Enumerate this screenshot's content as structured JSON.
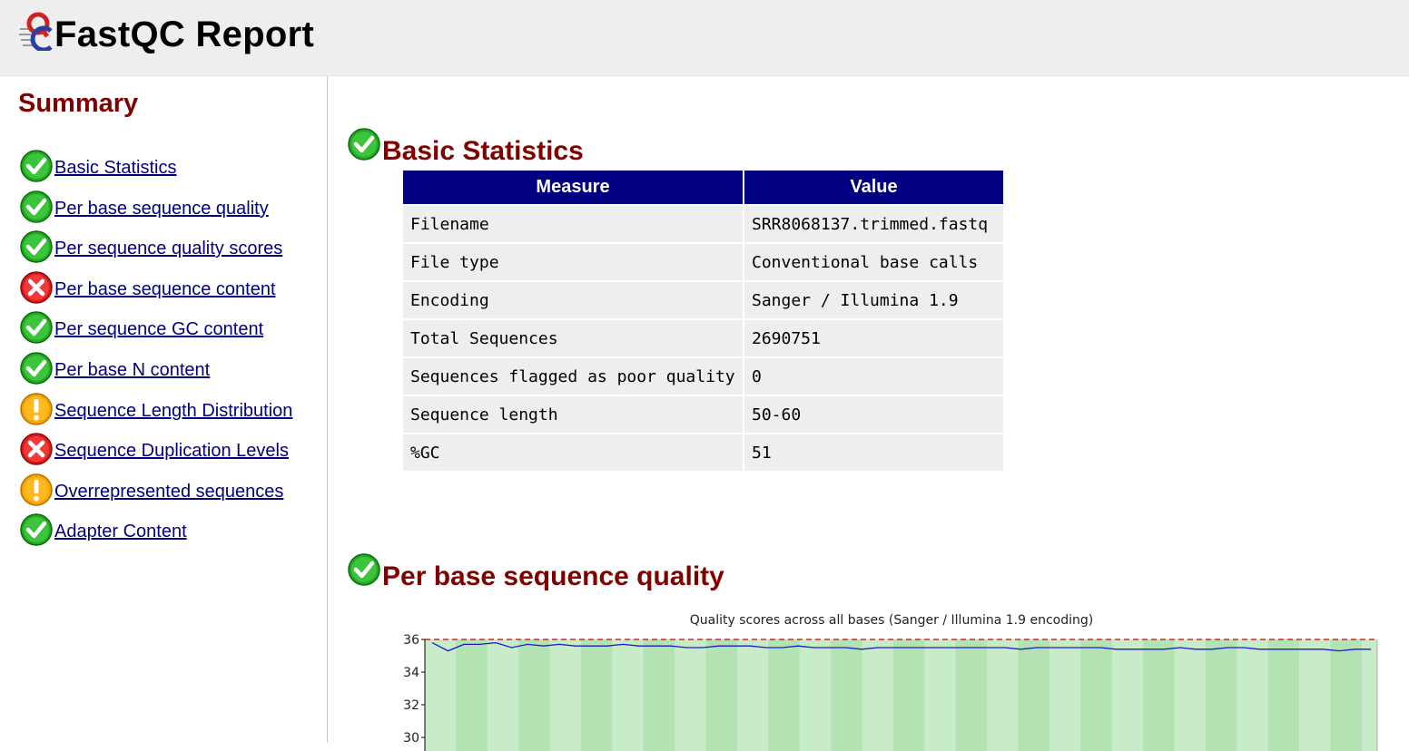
{
  "header": {
    "title": "FastQC Report"
  },
  "sidebar": {
    "title": "Summary",
    "items": [
      {
        "label": "Basic Statistics",
        "status": "pass"
      },
      {
        "label": "Per base sequence quality",
        "status": "pass"
      },
      {
        "label": "Per sequence quality scores",
        "status": "pass"
      },
      {
        "label": "Per base sequence content",
        "status": "fail"
      },
      {
        "label": "Per sequence GC content",
        "status": "pass"
      },
      {
        "label": "Per base N content",
        "status": "pass"
      },
      {
        "label": "Sequence Length Distribution",
        "status": "warn"
      },
      {
        "label": "Sequence Duplication Levels",
        "status": "fail"
      },
      {
        "label": "Overrepresented sequences",
        "status": "warn"
      },
      {
        "label": "Adapter Content",
        "status": "pass"
      }
    ]
  },
  "basic_stats": {
    "title": "Basic Statistics",
    "status": "pass",
    "header_measure": "Measure",
    "header_value": "Value",
    "rows": [
      {
        "measure": "Filename",
        "value": "SRR8068137.trimmed.fastq"
      },
      {
        "measure": "File type",
        "value": "Conventional base calls"
      },
      {
        "measure": "Encoding",
        "value": "Sanger / Illumina 1.9"
      },
      {
        "measure": "Total Sequences",
        "value": "2690751"
      },
      {
        "measure": "Sequences flagged as poor quality",
        "value": "0"
      },
      {
        "measure": "Sequence length",
        "value": "50-60"
      },
      {
        "measure": "%GC",
        "value": "51"
      }
    ]
  },
  "per_base_quality": {
    "title": "Per base sequence quality",
    "status": "pass"
  },
  "colors": {
    "pass": "#22a822",
    "fail": "#dd1a1a",
    "warn": "#f5a300",
    "heading": "#800000",
    "table_header": "#000080"
  },
  "chart_data": {
    "type": "line",
    "title": "Quality scores across all bases (Sanger / Illumina 1.9 encoding)",
    "ylim": [
      30,
      36
    ],
    "yticks": [
      30,
      32,
      34,
      36
    ],
    "grid": "alternating vertical bands",
    "series": [
      {
        "values": [
          35.8,
          35.3,
          35.7,
          35.7,
          35.8,
          35.5,
          35.7,
          35.6,
          35.7,
          35.6,
          35.6,
          35.6,
          35.7,
          35.6,
          35.6,
          35.6,
          35.5,
          35.5,
          35.6,
          35.6,
          35.6,
          35.5,
          35.5,
          35.6,
          35.5,
          35.5,
          35.5,
          35.4,
          35.5,
          35.5,
          35.5,
          35.5,
          35.5,
          35.5,
          35.5,
          35.5,
          35.5,
          35.4,
          35.5,
          35.5,
          35.5,
          35.5,
          35.5,
          35.4,
          35.4,
          35.4,
          35.4,
          35.5,
          35.4,
          35.4,
          35.5,
          35.5,
          35.4,
          35.4,
          35.4,
          35.4,
          35.4,
          35.3,
          35.4,
          35.4
        ]
      }
    ]
  }
}
